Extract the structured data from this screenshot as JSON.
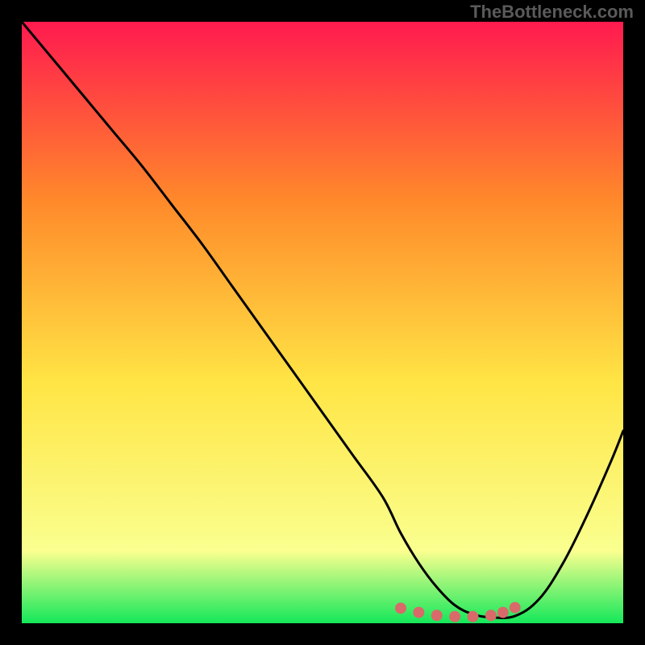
{
  "watermark": "TheBottleneck.com",
  "chart_data": {
    "type": "line",
    "title": "",
    "xlabel": "",
    "ylabel": "",
    "xlim": [
      0,
      100
    ],
    "ylim": [
      0,
      100
    ],
    "background_gradient": {
      "top": "#ff1a4f",
      "upper_mid": "#ff8a2a",
      "mid": "#ffe545",
      "lower": "#faff8f",
      "bottom": "#14e85a"
    },
    "series": [
      {
        "name": "bottleneck-curve",
        "color": "#000000",
        "x": [
          0,
          5,
          10,
          15,
          20,
          25,
          30,
          35,
          40,
          45,
          50,
          55,
          60,
          63,
          66,
          69,
          72,
          75,
          78,
          82,
          86,
          90,
          94,
          98,
          100
        ],
        "y": [
          100,
          94,
          88,
          82,
          76,
          69.5,
          63,
          56,
          49,
          42,
          35,
          28,
          21,
          15,
          10,
          6,
          3,
          1.5,
          1,
          1.2,
          4,
          10,
          18,
          27,
          32
        ]
      }
    ],
    "markers": {
      "name": "optimal-zone",
      "color": "#d96a6a",
      "x": [
        63,
        66,
        69,
        72,
        75,
        78,
        80,
        82
      ],
      "y": [
        2.5,
        1.8,
        1.3,
        1.1,
        1.1,
        1.3,
        1.8,
        2.6
      ]
    }
  }
}
